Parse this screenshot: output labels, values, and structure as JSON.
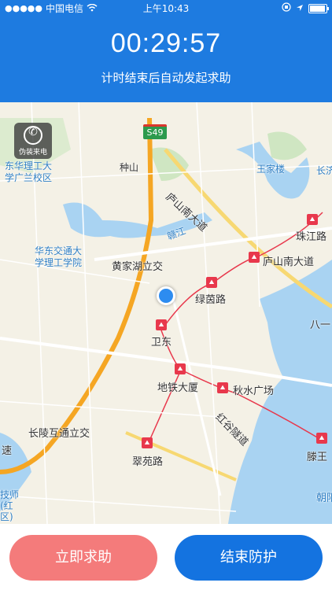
{
  "status_bar": {
    "signal": "●●●●●",
    "carrier": "中国电信",
    "time": "上午10:43"
  },
  "header": {
    "timer": "00:29:57",
    "subtitle": "计时结束后自动发起求助"
  },
  "map": {
    "fake_call_label": "伪装来电",
    "highway_badge": "S49",
    "labels": {
      "donghua": "东华理工大\n学广兰校区",
      "zhongshan": "种山",
      "wangjialou": "王家楼",
      "chang": "长济",
      "lushan_dadao": "庐山南大道",
      "ganjiang": "赣江",
      "zhujiang": "珠江路",
      "huadong": "华东交通大\n学理工学院",
      "huangjiahu": "黄家湖立交",
      "lushan_dadao2": "庐山南大道",
      "lvyin": "绿茵路",
      "ba": "八一",
      "weidong": "卫东",
      "ditie": "地铁大厦",
      "qiushui": "秋水广场",
      "honggu": "红谷隧道",
      "changling": "长陵互通立交",
      "su": "速",
      "cuiyuan": "翠苑路",
      "tengwang": "滕王",
      "chao": "朝阳",
      "jishi": "技师\n(红\n区)"
    }
  },
  "actions": {
    "help_label": "立即求助",
    "end_label": "结束防护"
  },
  "colors": {
    "header_bg": "#1e7be0",
    "help_btn": "#f47b7b",
    "end_btn": "#1473e0",
    "metro": "#e8384c"
  }
}
